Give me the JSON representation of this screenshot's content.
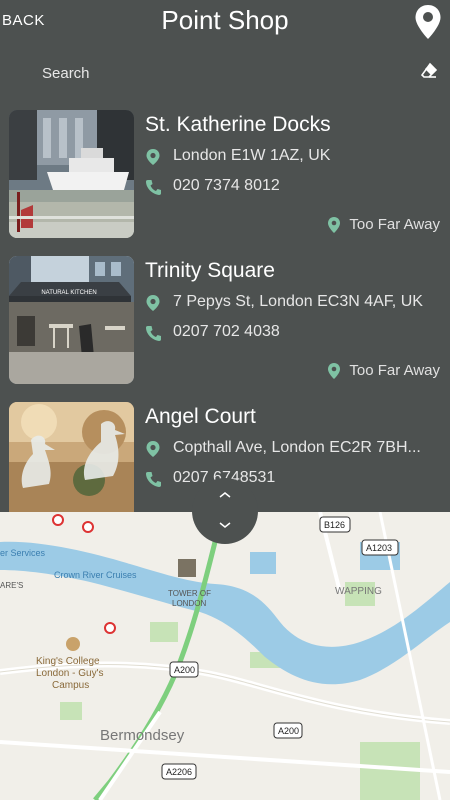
{
  "header": {
    "back_label": "BACK",
    "title": "Point Shop"
  },
  "search": {
    "placeholder": "Search",
    "value": ""
  },
  "shops": [
    {
      "name": "St. Katherine Docks",
      "address": "London E1W 1AZ, UK",
      "phone": "020 7374 8012",
      "distance": "Too Far Away"
    },
    {
      "name": "Trinity Square",
      "address": "7 Pepys St, London EC3N 4AF, UK",
      "phone": "0207 702 4038",
      "distance": "Too Far Away"
    },
    {
      "name": "Angel Court",
      "address": "Copthall Ave, London EC2R 7BH...",
      "phone": "0207 6748531",
      "distance": ""
    }
  ],
  "photo_signs": {
    "natural_kitchen": "NATURAL KITCHEN"
  },
  "map": {
    "labels": {
      "services": "er Services",
      "crown": "Crown River Cruises",
      "tower": "TOWER OF",
      "tower2": "LONDON",
      "wapping": "WAPPING",
      "kings1": "King's College",
      "kings2": "London - Guy's",
      "kings3": "Campus",
      "bermondsey": "Bermondsey",
      "ares": "ARE'S",
      "b126": "B126",
      "a1203": "A1203",
      "a200a": "A200",
      "a200b": "A200",
      "a2206": "A2206"
    }
  },
  "colors": {
    "accent": "#7fc2a4",
    "background": "#4d5150",
    "river": "#9ccbe6",
    "park": "#c7e3b7"
  }
}
